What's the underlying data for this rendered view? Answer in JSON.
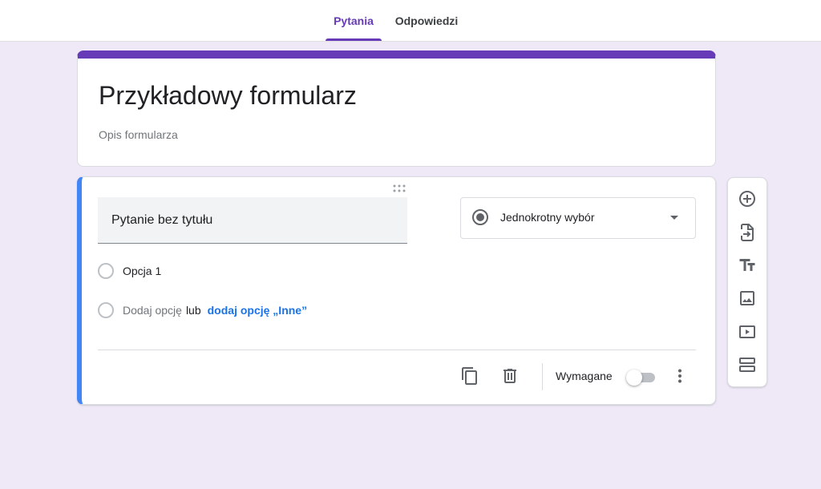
{
  "tabs": {
    "questions": "Pytania",
    "responses": "Odpowiedzi"
  },
  "form": {
    "title": "Przykładowy formularz",
    "description": "Opis formularza"
  },
  "question": {
    "title": "Pytanie bez tytułu",
    "type": "Jednokrotny wybór",
    "options": [
      "Opcja 1"
    ],
    "add_option": "Dodaj opcję",
    "or": "lub",
    "add_other": "dodaj opcję „Inne”",
    "required_label": "Wymagane",
    "required": false
  },
  "colors": {
    "accent": "#673ab7",
    "question_border": "#4285f4",
    "link": "#1a73e8",
    "background": "#efe9f7"
  },
  "side_toolbar": {
    "items": [
      "add-question-icon",
      "import-questions-icon",
      "add-title-icon",
      "add-image-icon",
      "add-video-icon",
      "add-section-icon"
    ]
  }
}
